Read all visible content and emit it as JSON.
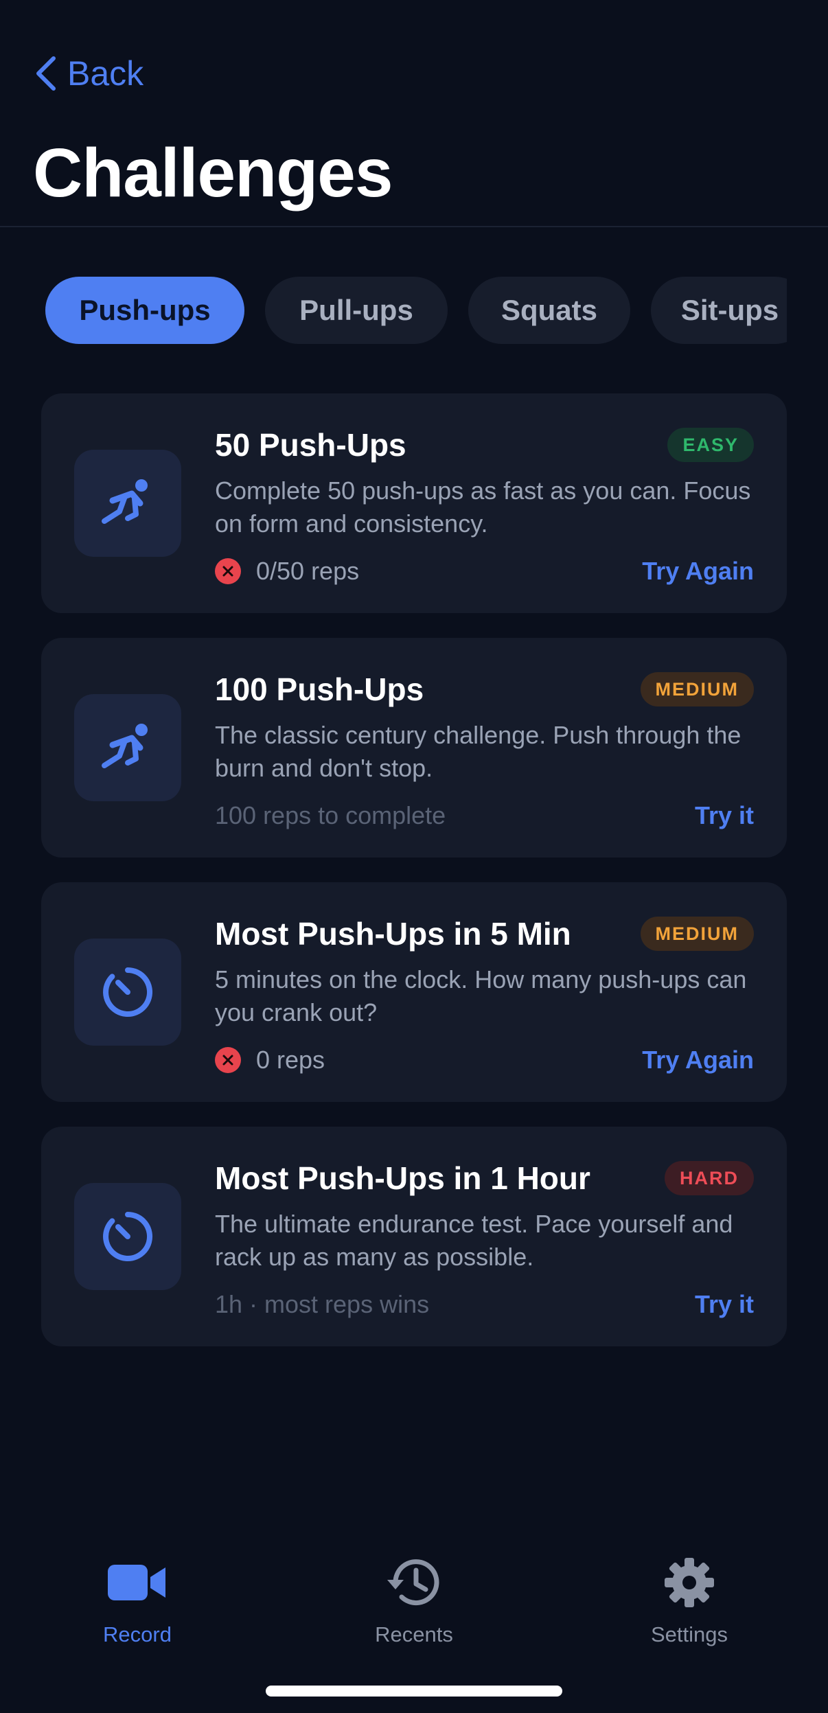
{
  "header": {
    "back_label": "Back",
    "title": "Challenges"
  },
  "tabs": [
    {
      "label": "Push-ups",
      "active": true
    },
    {
      "label": "Pull-ups",
      "active": false
    },
    {
      "label": "Squats",
      "active": false
    },
    {
      "label": "Sit-ups",
      "active": false
    }
  ],
  "cards": [
    {
      "icon": "push-up-figure-icon",
      "title": "50 Push-Ups",
      "badge": "EASY",
      "description": "Complete 50 push-ups as fast as you can. Focus on form and consistency.",
      "status": "0/50 reps",
      "status_failed": true,
      "action": "Try Again"
    },
    {
      "icon": "push-up-figure-icon",
      "title": "100 Push-Ups",
      "badge": "MEDIUM",
      "description": "The classic century challenge. Push through the burn and don't stop.",
      "status": "100 reps to complete",
      "status_failed": false,
      "action": "Try it"
    },
    {
      "icon": "timer-icon",
      "title": "Most Push-Ups in 5 Min",
      "badge": "MEDIUM",
      "description": "5 minutes on the clock. How many push-ups can you crank out?",
      "status": "0 reps",
      "status_failed": true,
      "action": "Try Again"
    },
    {
      "icon": "timer-icon",
      "title": "Most Push-Ups in 1 Hour",
      "badge": "HARD",
      "description": "The ultimate endurance test. Pace yourself and rack up as many as possible.",
      "status": "1h  · most reps wins",
      "status_failed": false,
      "action": "Try it"
    }
  ],
  "nav": [
    {
      "label": "Record",
      "icon": "video-camera-icon",
      "active": true
    },
    {
      "label": "Recents",
      "icon": "history-clock-icon",
      "active": false
    },
    {
      "label": "Settings",
      "icon": "gear-icon",
      "active": false
    }
  ],
  "colors": {
    "background": "#0a0f1c",
    "card": "#151b2a",
    "accent": "#4f7ff2",
    "easy": "#2fb86c",
    "medium": "#f2a33a",
    "hard": "#ee4d57",
    "failed": "#e8444d"
  }
}
